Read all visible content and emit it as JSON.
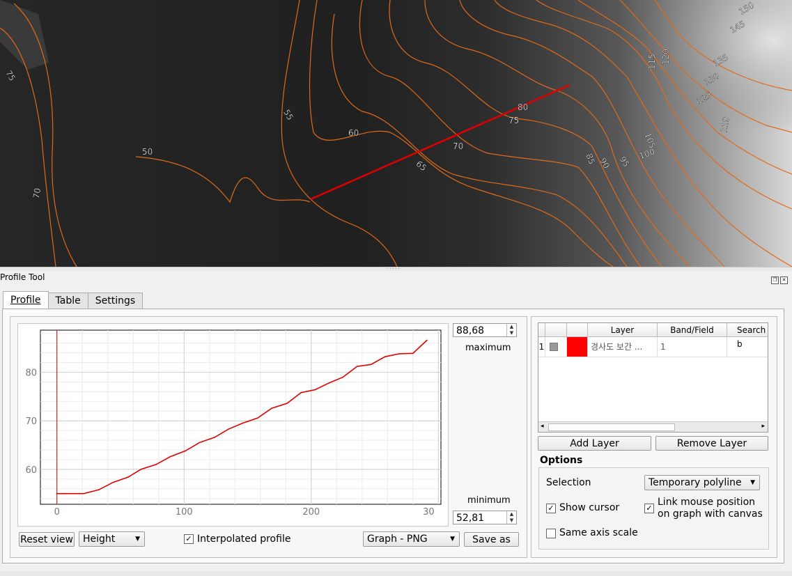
{
  "map": {
    "contour_labels": [
      "75",
      "70",
      "50",
      "55",
      "60",
      "65",
      "70",
      "75",
      "80",
      "85",
      "90",
      "95",
      "100",
      "105",
      "110",
      "115",
      "120",
      "125",
      "130",
      "135",
      "145",
      "150"
    ]
  },
  "dock": {
    "title": "Profile Tool"
  },
  "tabs": [
    {
      "label": "Profile",
      "active": true
    },
    {
      "label": "Table",
      "active": false
    },
    {
      "label": "Settings",
      "active": false
    }
  ],
  "maximum": {
    "value": "88,68",
    "label": "maximum"
  },
  "minimum": {
    "value": "52,81",
    "label": "minimum"
  },
  "chart_data": {
    "type": "line",
    "x_ticks": [
      "0",
      "100",
      "200",
      "30"
    ],
    "y_ticks": [
      "60",
      "70",
      "80"
    ],
    "xlim": [
      -13,
      302
    ],
    "ylim": [
      52.81,
      88.68
    ],
    "line_color": "#e00000",
    "series": [
      {
        "x": [
          0,
          21,
          33,
          44,
          56,
          66,
          78,
          89,
          101,
          112,
          124,
          135,
          146,
          158,
          169,
          181,
          192,
          203,
          214,
          225,
          236,
          247,
          258,
          269,
          280,
          291
        ],
        "values": [
          55.0,
          55.0,
          55.8,
          57.3,
          58.4,
          60.0,
          61.0,
          62.6,
          63.8,
          65.5,
          66.6,
          68.3,
          69.5,
          70.6,
          72.6,
          73.6,
          75.8,
          76.4,
          77.8,
          79.0,
          81.2,
          81.6,
          83.2,
          83.8,
          83.9,
          86.6
        ]
      }
    ]
  },
  "buttons": {
    "reset_view": "Reset view",
    "save_as": "Save as",
    "add_layer": "Add Layer",
    "remove_layer": "Remove Layer"
  },
  "combos": {
    "height": "Height",
    "graph_format": "Graph - PNG",
    "selection": "Temporary polyline"
  },
  "checkboxes": {
    "interpolated": {
      "label": "Interpolated profile",
      "checked": true
    },
    "show_cursor": {
      "label": "Show cursor",
      "checked": true
    },
    "link_mouse_line1": "Link mouse position",
    "link_mouse_line2": "on graph with canvas",
    "link_mouse_checked": true,
    "same_axis": {
      "label": "Same axis scale",
      "checked": false
    }
  },
  "layer_table": {
    "headers": [
      "Layer",
      "Band/Field",
      "Search b"
    ],
    "rows": [
      {
        "index": "1",
        "layer": "경사도 보간 ...",
        "band": "1",
        "color": "#ff0000"
      }
    ]
  },
  "options": {
    "title": "Options",
    "selection_label": "Selection"
  }
}
